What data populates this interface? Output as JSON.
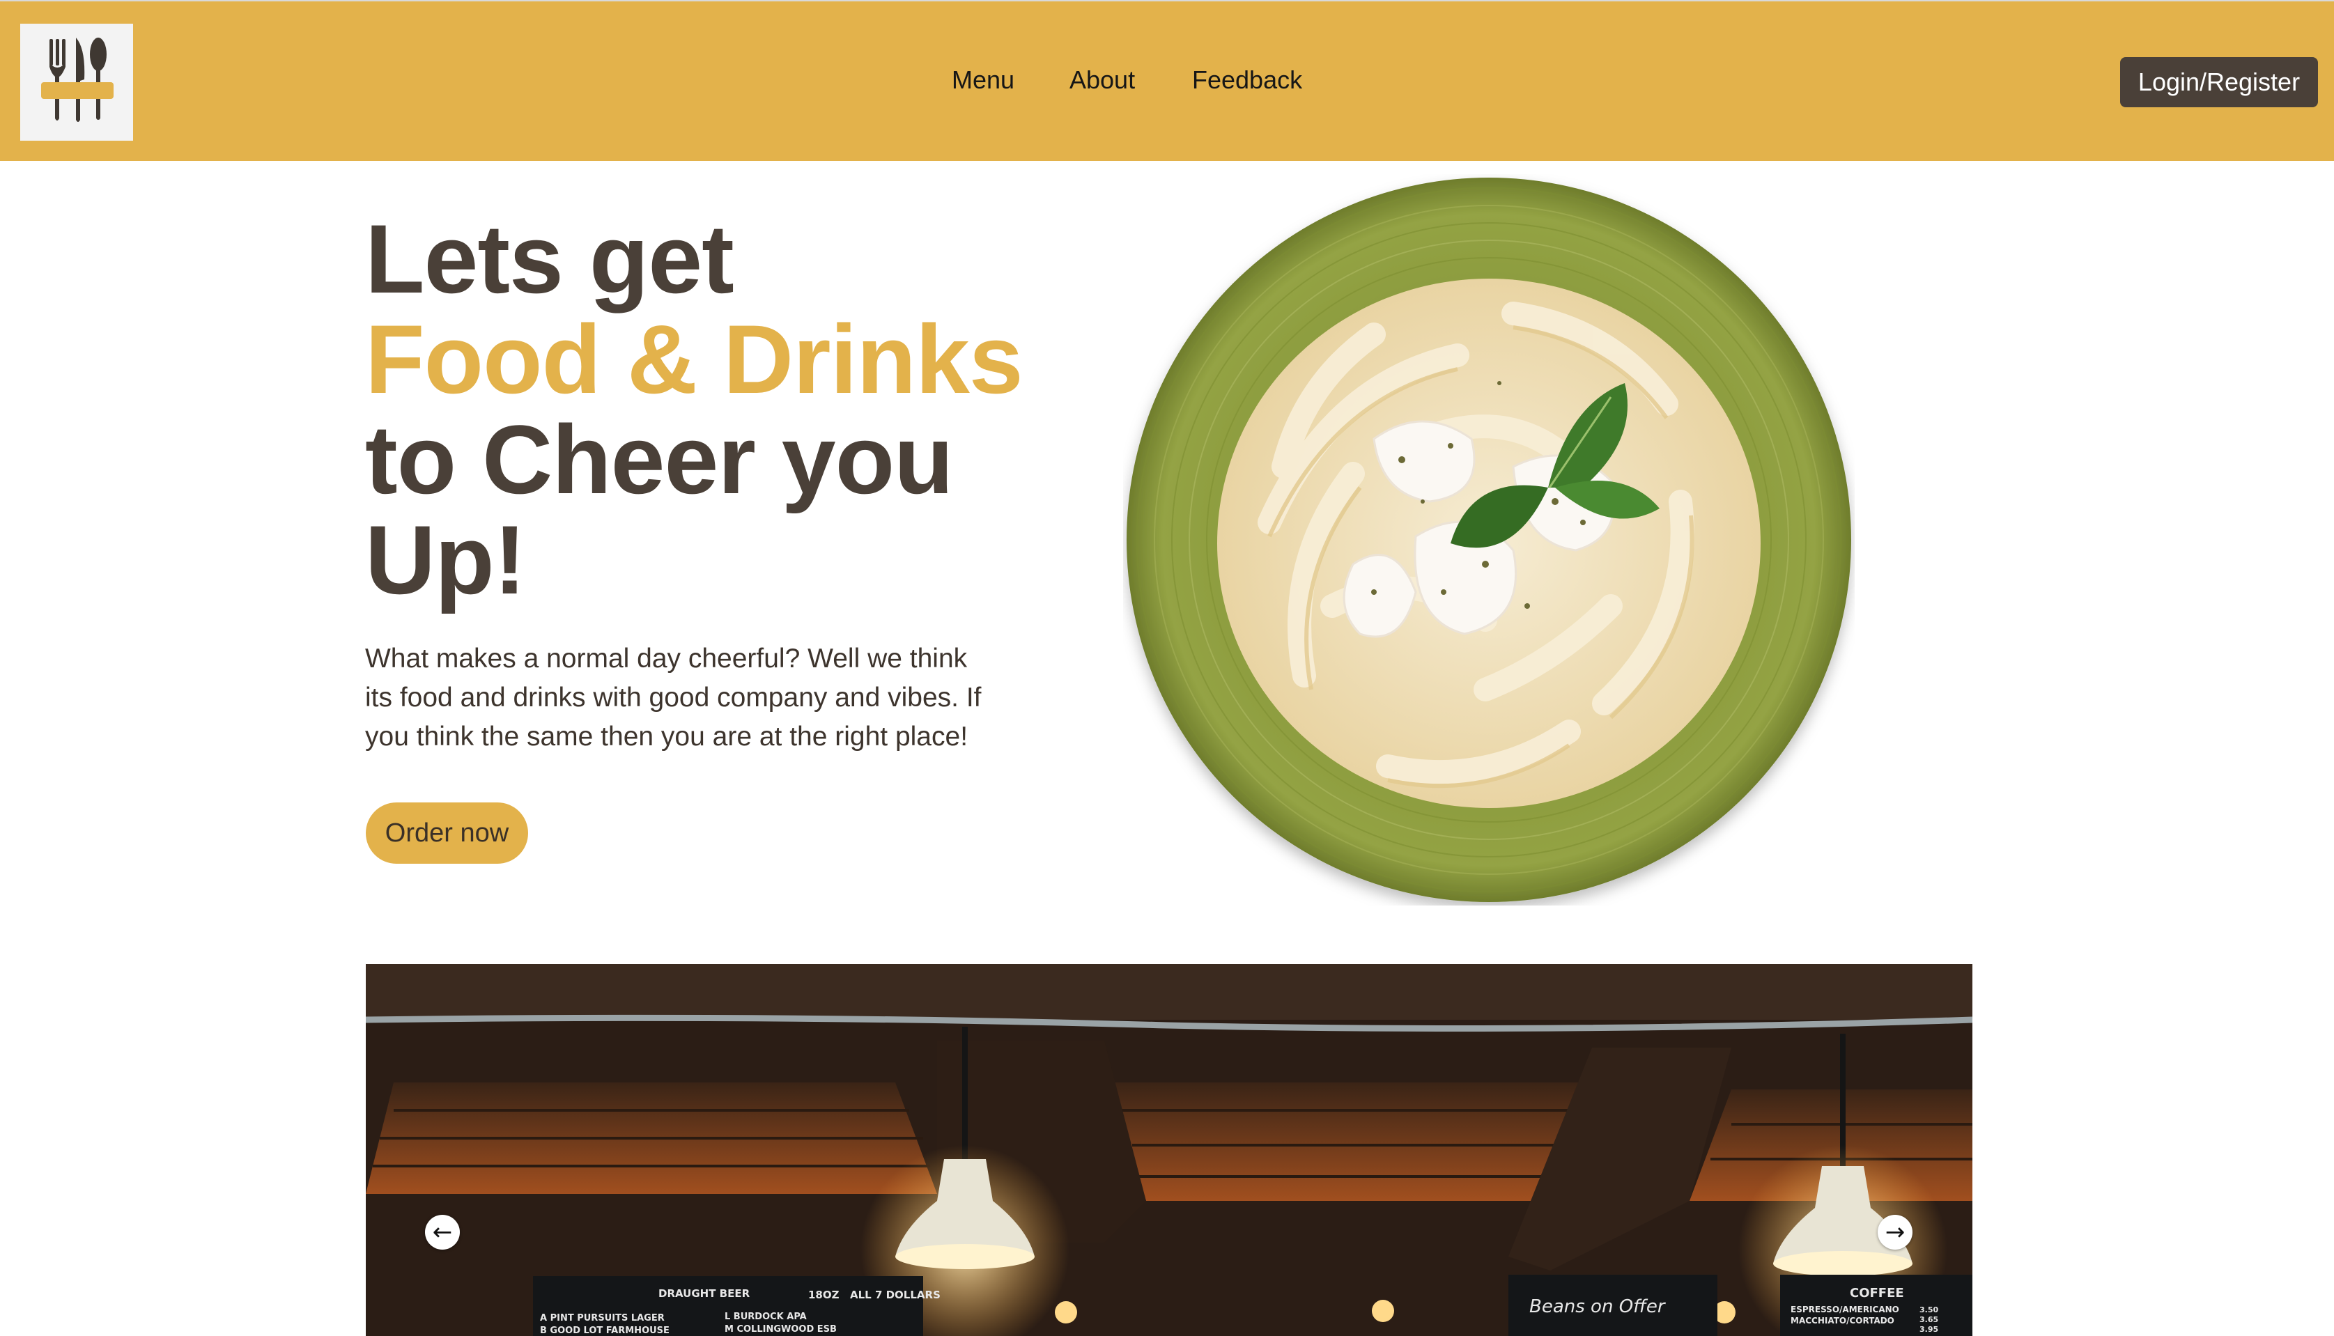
{
  "header": {
    "logo_icon": "cutlery-logo-icon",
    "nav": [
      {
        "label": "Menu"
      },
      {
        "label": "About"
      },
      {
        "label": "Feedback"
      }
    ],
    "login_label": "Login/Register"
  },
  "hero": {
    "title_line1": "Lets get",
    "title_line2": "Food & Drinks",
    "title_line3": "to Cheer you",
    "title_line4": "Up!",
    "description_line1": "What makes a normal day cheerful? Well we think",
    "description_line2": "its food and drinks with good company and vibes. If",
    "description_line3": "you think the same then you are at the right place!",
    "order_label": "Order now",
    "image_icon": "pasta-plate-image"
  },
  "carousel": {
    "image_icon": "restaurant-interior-image",
    "prev_icon": "arrow-left-icon",
    "next_icon": "arrow-right-icon",
    "prev_symbol": "←",
    "next_symbol": "→",
    "sign_left_title": "DRAUGHT  BEER",
    "sign_left_col1": "18OZ",
    "sign_left_col2": "ALL 7 DOLLARS",
    "sign_left_row1a": "A PINT PURSUITS LAGER",
    "sign_left_row1b": "L BURDOCK  APA",
    "sign_left_row2a": "B GOOD LOT  FARMHOUSE",
    "sign_left_row2b": "M COLLINGWOOD  ESB",
    "sign_mid": "Beans on Offer",
    "sign_right_title": "COFFEE",
    "sign_right_row1": "ESPRESSO/AMERICANO",
    "sign_right_row2": "MACCHIATO/CORTADO",
    "sign_right_price1": "3.50",
    "sign_right_price2": "3.65",
    "sign_right_price3": "3.95"
  },
  "colors": {
    "accent": "#e3b24b",
    "dark": "#4a4038",
    "plate": "#8a9b3d"
  }
}
